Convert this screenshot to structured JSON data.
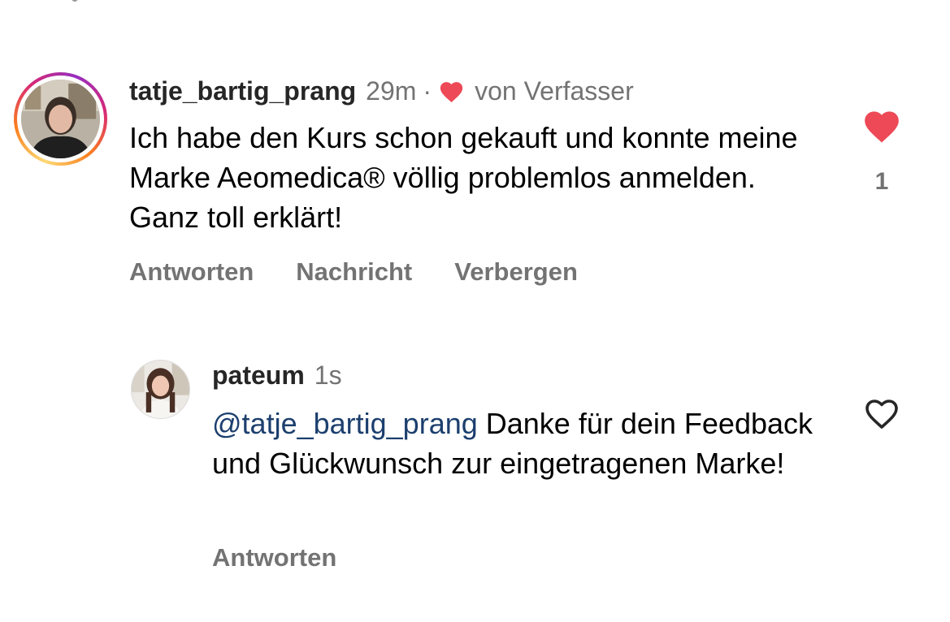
{
  "comment": {
    "username": "tatje_bartig_prang",
    "time": "29m",
    "separator": "·",
    "liked_by_author_label": "von Verfasser",
    "text": "Ich habe den Kurs schon gekauft und konnte meine Marke Aeomedica® völlig problemlos anmelden. Ganz toll erklärt!",
    "actions": {
      "reply": "Antworten",
      "message": "Nachricht",
      "hide": "Verbergen"
    },
    "like_count": "1",
    "liked": true
  },
  "reply": {
    "username": "pateum",
    "time": "1s",
    "mention": "@tatje_bartig_prang",
    "text": " Danke für dein Feedback und Glückwunsch zur eingetragenen Marke!",
    "actions": {
      "reply": "Antworten"
    },
    "liked": false
  },
  "colors": {
    "heart_red": "#ed4956",
    "secondary_text": "#737373",
    "mention_blue": "#1c3f6e"
  },
  "icons": {
    "author_heart": "heart-filled-icon",
    "comment_like": "heart-filled-icon",
    "reply_like": "heart-outline-icon"
  }
}
